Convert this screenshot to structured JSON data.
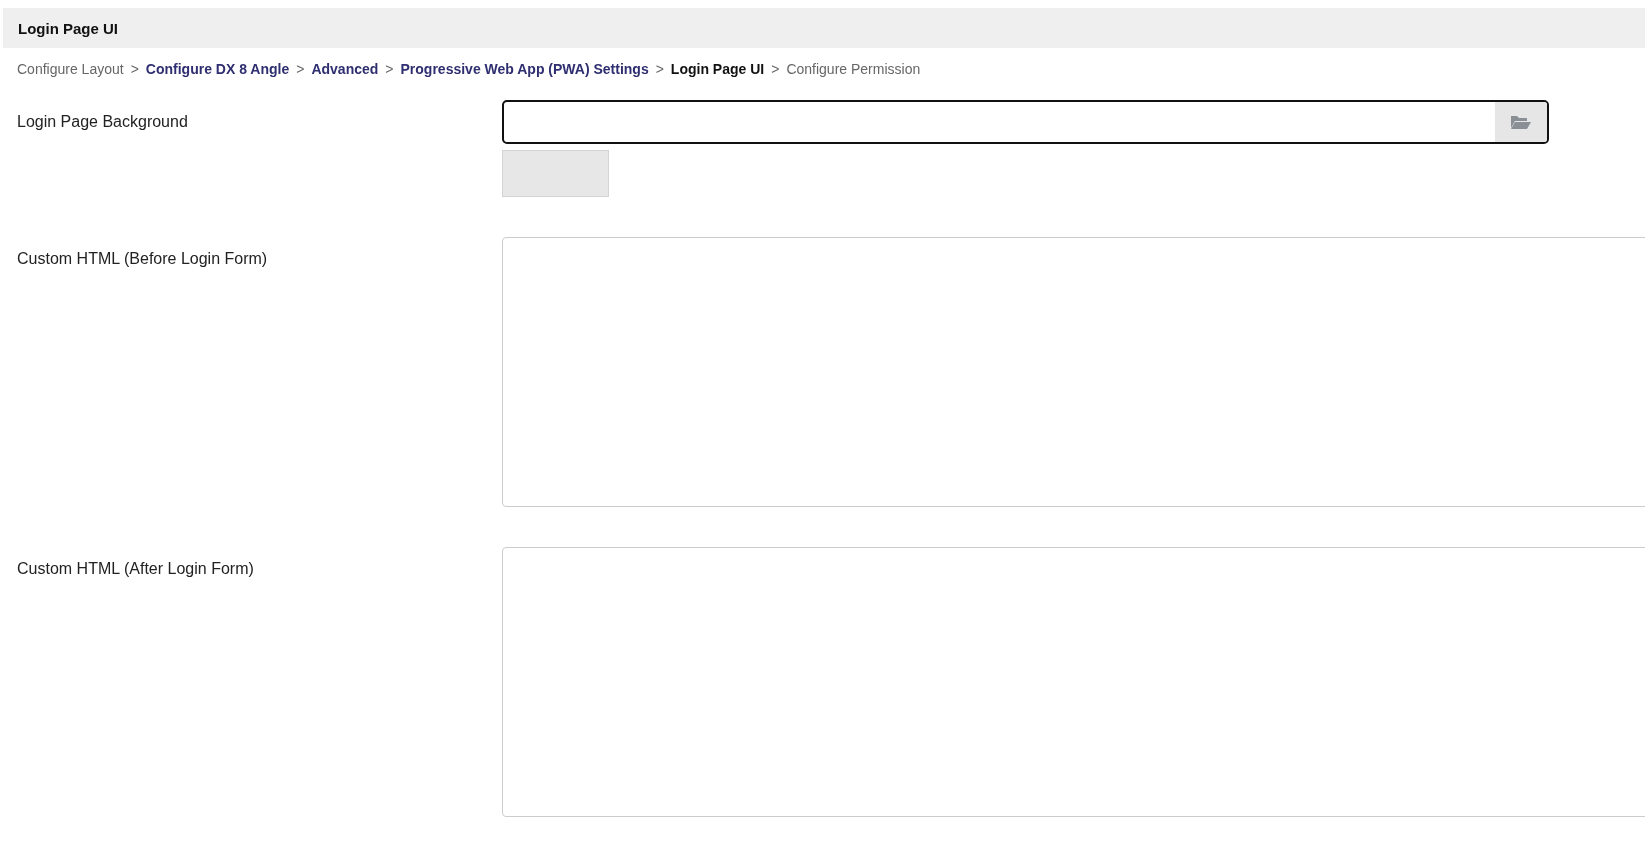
{
  "header": {
    "title": "Login Page UI"
  },
  "breadcrumb": [
    {
      "label": "Configure Layout",
      "kind": "plain"
    },
    {
      "label": "Configure DX 8 Angle",
      "kind": "link"
    },
    {
      "label": "Advanced",
      "kind": "link"
    },
    {
      "label": "Progressive Web App (PWA) Settings",
      "kind": "link"
    },
    {
      "label": "Login Page UI",
      "kind": "current"
    },
    {
      "label": "Configure Permission",
      "kind": "plain"
    }
  ],
  "separator": ">",
  "fields": [
    {
      "label": "Login Page Background",
      "kind": "file",
      "focused": true
    },
    {
      "label": "Custom HTML (Before Login Form)",
      "kind": "textarea"
    },
    {
      "label": "Custom HTML (After Login Form)",
      "kind": "textarea"
    }
  ]
}
